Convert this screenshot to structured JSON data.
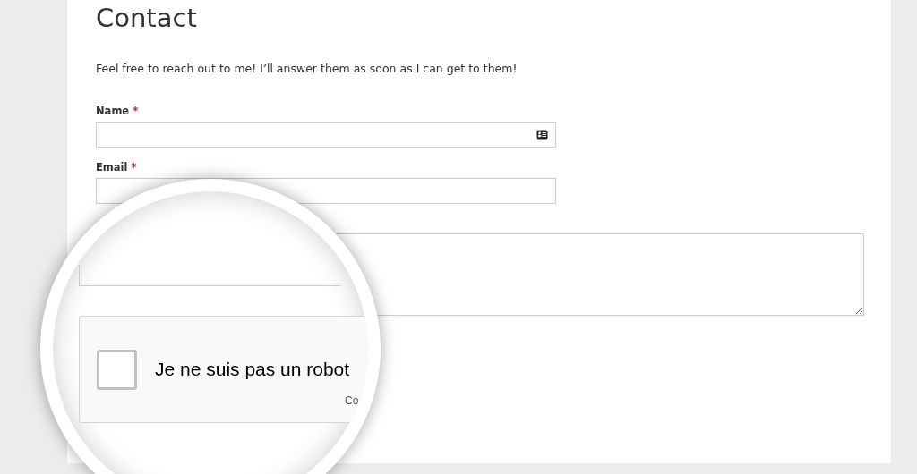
{
  "heading": "Contact",
  "intro": "Feel free to reach out to me! I’ll answer them as soon as I can get to them!",
  "required_mark": "*",
  "fields": [
    {
      "kind": "contact-card",
      "label": "Name",
      "required": true
    },
    {
      "kind": "plain",
      "label": "Email",
      "required": true
    },
    {
      "kind": "textarea"
    }
  ],
  "magnifier": {
    "captcha": {
      "label": "Je ne suis pas un robot",
      "checked": false,
      "footer": "Co"
    }
  }
}
